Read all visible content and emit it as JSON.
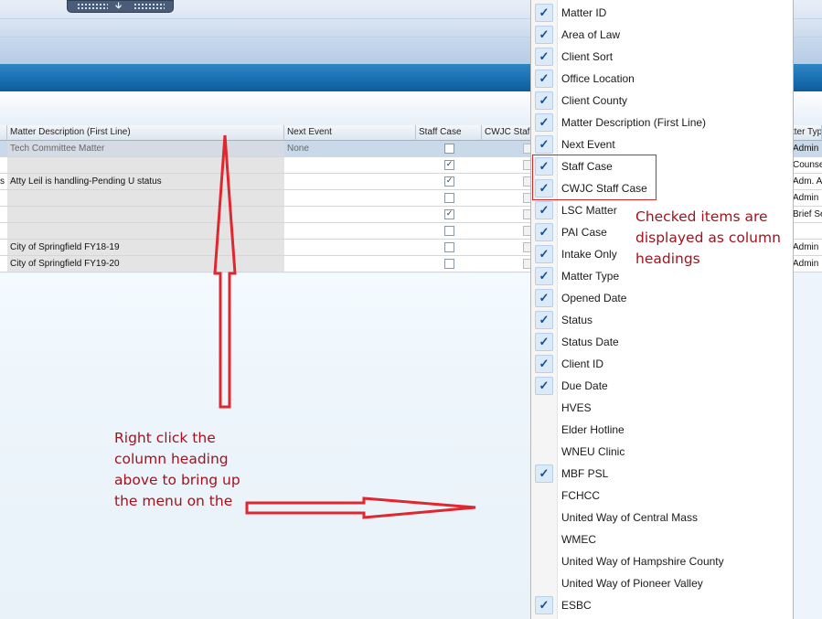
{
  "colors": {
    "accent_blue": "#1a72b5",
    "annotation_red": "#d8242b",
    "annotation_text": "#a3121c",
    "selected_row": "#c9d9ea"
  },
  "toolbar": {
    "grip_icon": "down-arrow-icon"
  },
  "grid": {
    "columns": [
      "Matter Description (First Line)",
      "Next Event",
      "Staff Case",
      "CWJC Staf",
      "tter Typ"
    ],
    "rows": [
      {
        "left_fragment": "",
        "description": "Tech Committee Matter",
        "next_event": "None",
        "staff_case": "unchecked",
        "cwjc": "unchecked",
        "type": "Admin"
      },
      {
        "left_fragment": "",
        "description": "",
        "next_event": "",
        "staff_case": "checked",
        "cwjc": "unchecked",
        "type": "Counse"
      },
      {
        "left_fragment": "s",
        "description": "Atty Leil is handling-Pending U status",
        "next_event": "",
        "staff_case": "checked",
        "cwjc": "unchecked",
        "type": "Adm. A"
      },
      {
        "left_fragment": "",
        "description": "",
        "next_event": "",
        "staff_case": "unchecked",
        "cwjc": "unchecked",
        "type": "Admin"
      },
      {
        "left_fragment": "",
        "description": "",
        "next_event": "",
        "staff_case": "checked",
        "cwjc": "unchecked",
        "type": "Brief Se"
      },
      {
        "left_fragment": "",
        "description": "",
        "next_event": "",
        "staff_case": "unchecked",
        "cwjc": "unchecked",
        "type": ""
      },
      {
        "left_fragment": "",
        "description": "City of Springfield FY18-19",
        "next_event": "",
        "staff_case": "unchecked",
        "cwjc": "unchecked",
        "type": "Admin"
      },
      {
        "left_fragment": "",
        "description": "City of Springfield FY19-20",
        "next_event": "",
        "staff_case": "unchecked",
        "cwjc": "unchecked",
        "type": "Admin"
      }
    ]
  },
  "menu": {
    "items": [
      {
        "label": "Matter ID",
        "checked": true
      },
      {
        "label": "Area of Law",
        "checked": true
      },
      {
        "label": "Client Sort",
        "checked": true
      },
      {
        "label": "Office Location",
        "checked": true
      },
      {
        "label": "Client County",
        "checked": true
      },
      {
        "label": "Matter Description (First Line)",
        "checked": true
      },
      {
        "label": "Next Event",
        "checked": true
      },
      {
        "label": "Staff Case",
        "checked": true
      },
      {
        "label": "CWJC Staff Case",
        "checked": true
      },
      {
        "label": "LSC Matter",
        "checked": true
      },
      {
        "label": "PAI Case",
        "checked": true
      },
      {
        "label": "Intake Only",
        "checked": true
      },
      {
        "label": "Matter Type",
        "checked": true
      },
      {
        "label": "Opened Date",
        "checked": true
      },
      {
        "label": "Status",
        "checked": true
      },
      {
        "label": "Status Date",
        "checked": true
      },
      {
        "label": "Client ID",
        "checked": true
      },
      {
        "label": "Due Date",
        "checked": true
      },
      {
        "label": "HVES",
        "checked": false
      },
      {
        "label": "Elder Hotline",
        "checked": false
      },
      {
        "label": "WNEU Clinic",
        "checked": false
      },
      {
        "label": "MBF PSL",
        "checked": true
      },
      {
        "label": "FCHCC",
        "checked": false
      },
      {
        "label": "United Way of Central Mass",
        "checked": false
      },
      {
        "label": "WMEC",
        "checked": false
      },
      {
        "label": "United Way of Hampshire County",
        "checked": false
      },
      {
        "label": "United Way of Pioneer Valley",
        "checked": false
      },
      {
        "label": "ESBC",
        "checked": true
      }
    ]
  },
  "annotations": {
    "checked_note": "Checked items are displayed as column headings",
    "right_click_note": "Right click the column heading above to bring up the menu on the"
  }
}
